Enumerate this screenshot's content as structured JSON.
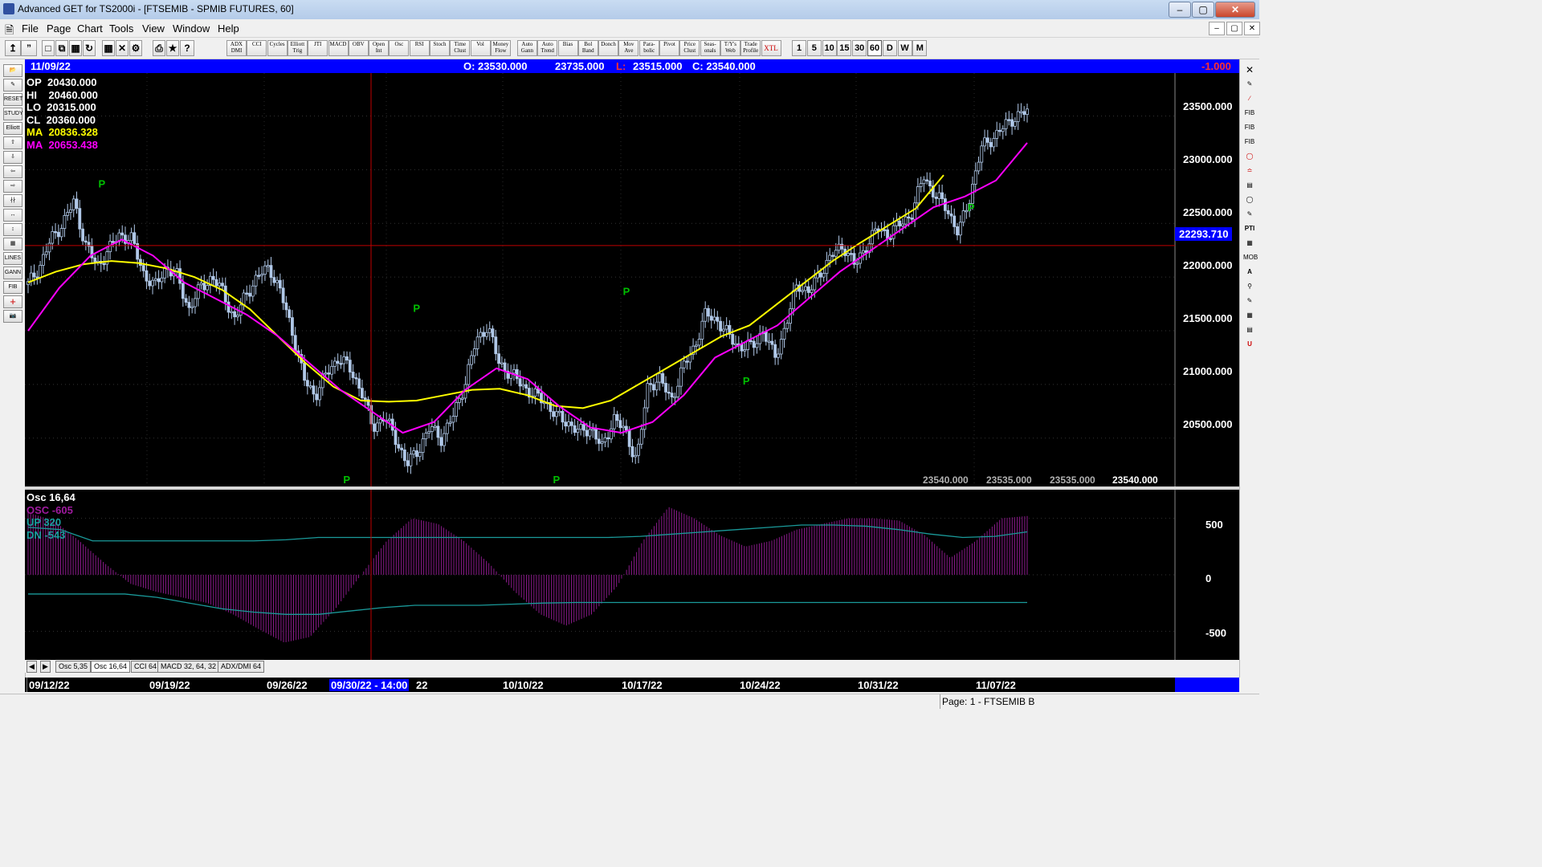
{
  "window": {
    "title": "Advanced GET for TS2000i - [FTSEMIB - SPMIB FUTURES, 60]",
    "controls": [
      "–",
      "▢",
      "✕"
    ]
  },
  "menu": [
    "File",
    "Page",
    "Chart",
    "Tools",
    "View",
    "Window",
    "Help"
  ],
  "toolbar": {
    "study_buttons": [
      "ADX DMI",
      "CCI",
      "Cycles",
      "Elliott Trig",
      "JTI",
      "MACD",
      "OBV",
      "Open Int",
      "Osc",
      "RSI",
      "Stoch",
      "Time Clust",
      "Vol",
      "Money Flow",
      "Auto Gann",
      "Auto Trend",
      "Bias",
      "Bol Band",
      "Donch",
      "Mov Ave",
      "Para-bolic",
      "Pivot",
      "Price Clust",
      "Seas-onals",
      "T/Y's Web",
      "Trade Profile",
      "XTL"
    ],
    "intervals": [
      "1",
      "5",
      "10",
      "15",
      "30",
      "60",
      "D",
      "W",
      "M"
    ],
    "active_interval": "60"
  },
  "info_bar": {
    "date": "11/09/22",
    "open": "O: 23530.000",
    "high": "23735.000",
    "low_label": "L:",
    "low": "23515.000",
    "close": "C: 23540.000",
    "change": "-1.000"
  },
  "price_legend": [
    {
      "label": "OP",
      "value": "20430.000",
      "color": "#ffffff"
    },
    {
      "label": "HI",
      "value": "20460.000",
      "color": "#ffffff"
    },
    {
      "label": "LO",
      "value": "20315.000",
      "color": "#ffffff"
    },
    {
      "label": "CL",
      "value": "20360.000",
      "color": "#ffffff"
    },
    {
      "label": "MA",
      "value": "20836.328",
      "color": "#ffff00"
    },
    {
      "label": "MA",
      "value": "20653.438",
      "color": "#ff00ff"
    }
  ],
  "price_axis": [
    "23500.000",
    "23000.000",
    "22500.000",
    "22000.000",
    "21500.000",
    "21000.000",
    "20500.000"
  ],
  "crosshair_price": "22293.710",
  "pivot_marker": "P",
  "bottom_readout": [
    "23540.000",
    "23535.000",
    "23535.000",
    "23540.000"
  ],
  "osc_legend": {
    "title": "Osc 16,64",
    "osc": "OSC -605",
    "up": "UP  320",
    "dn": "DN  -543"
  },
  "osc_axis": [
    "500",
    "0",
    "-500"
  ],
  "tabs": [
    "Osc 5,35",
    "Osc 16,64",
    "CCI 64",
    "MACD 32, 64, 32",
    "ADX/DMI 64"
  ],
  "active_tab": "Osc 16,64",
  "dates": [
    "09/12/22",
    "09/19/22",
    "09/26/22",
    "09/30/22 - 14:00",
    "22",
    "10/10/22",
    "10/17/22",
    "10/24/22",
    "10/31/22",
    "11/07/22"
  ],
  "status": "Page: 1 - FTSEMIB B",
  "colors": {
    "ma_fast": "#ffff00",
    "ma_slow": "#ff00ff",
    "bars": "#b0c8e8",
    "pivot": "#00c000",
    "crosshair": "#c00000",
    "osc_hist": "#8a1a8a",
    "osc_bands": "#1a9a9a"
  },
  "chart_data": {
    "type": "candlestick",
    "symbol": "FTSEMIB - SPMIB FUTURES",
    "interval": "60",
    "ylim": [
      20050,
      23900
    ],
    "closes": [
      21930,
      22100,
      22350,
      22500,
      22700,
      22300,
      22100,
      22250,
      22400,
      22350,
      22050,
      21900,
      22100,
      22000,
      21700,
      21900,
      22000,
      21850,
      21600,
      21850,
      22000,
      22100,
      21850,
      21500,
      21050,
      20900,
      21100,
      21250,
      21150,
      20950,
      20600,
      20700,
      20500,
      20250,
      20400,
      20600,
      20500,
      20700,
      21000,
      21400,
      21550,
      21200,
      21100,
      21000,
      20900,
      20850,
      20700,
      20650,
      20550,
      20600,
      20400,
      20700,
      20550,
      20300,
      21000,
      21050,
      20850,
      21150,
      21350,
      21650,
      21600,
      21450,
      21350,
      21350,
      21500,
      21250,
      21550,
      21950,
      21850,
      22050,
      22200,
      22300,
      22100,
      22300,
      22450,
      22400,
      22500,
      22600,
      22950,
      22750,
      22650,
      22400,
      22750,
      23200,
      23300,
      23400,
      23500,
      23540
    ],
    "ma_fast": [
      21950,
      22050,
      22120,
      22150,
      22130,
      22080,
      22000,
      21880,
      21700,
      21450,
      21200,
      20980,
      20850,
      20840,
      20850,
      20900,
      20950,
      20960,
      20900,
      20800,
      20780,
      20850,
      21000,
      21150,
      21300,
      21450,
      21550,
      21750,
      21950,
      22150,
      22320,
      22480,
      22640,
      22950
    ],
    "ma_slow": [
      21500,
      21900,
      22200,
      22350,
      22200,
      21950,
      21800,
      21650,
      21450,
      21200,
      20950,
      20750,
      20550,
      20650,
      20950,
      21150,
      21050,
      20800,
      20600,
      20550,
      20650,
      20900,
      21250,
      21400,
      21550,
      21800,
      22050,
      22250,
      22450,
      22650,
      22750,
      22900,
      23250
    ],
    "osc_ylim": [
      -700,
      700
    ],
    "osc": [
      550,
      480,
      300,
      100,
      -80,
      -150,
      -200,
      -250,
      -350,
      -480,
      -600,
      -550,
      -300,
      0,
      300,
      500,
      450,
      300,
      100,
      -150,
      -350,
      -450,
      -350,
      -100,
      300,
      600,
      500,
      350,
      250,
      300,
      400,
      450,
      500,
      500,
      480,
      350,
      150,
      300,
      500,
      520
    ],
    "osc_up": [
      420,
      400,
      300,
      300,
      300,
      300,
      300,
      300,
      310,
      330,
      330,
      330,
      330,
      330,
      330,
      330,
      330,
      330,
      330,
      340,
      360,
      380,
      400,
      420,
      440,
      440,
      430,
      400,
      360,
      330,
      340,
      380
    ],
    "osc_dn": [
      -170,
      -170,
      -170,
      -170,
      -200,
      -250,
      -300,
      -330,
      -350,
      -350,
      -320,
      -290,
      -270,
      -270,
      -270,
      -260,
      -250,
      -245,
      -245,
      -245,
      -245,
      -245,
      -245,
      -245,
      -245,
      -245,
      -245,
      -245,
      -245,
      -245,
      -245,
      -245
    ],
    "pivot_x": [
      0.035,
      0.28,
      0.35,
      0.49,
      0.56,
      0.68,
      0.905
    ],
    "pivot_y": [
      22700,
      20200,
      21540,
      20200,
      21700,
      21120,
      22480
    ]
  }
}
